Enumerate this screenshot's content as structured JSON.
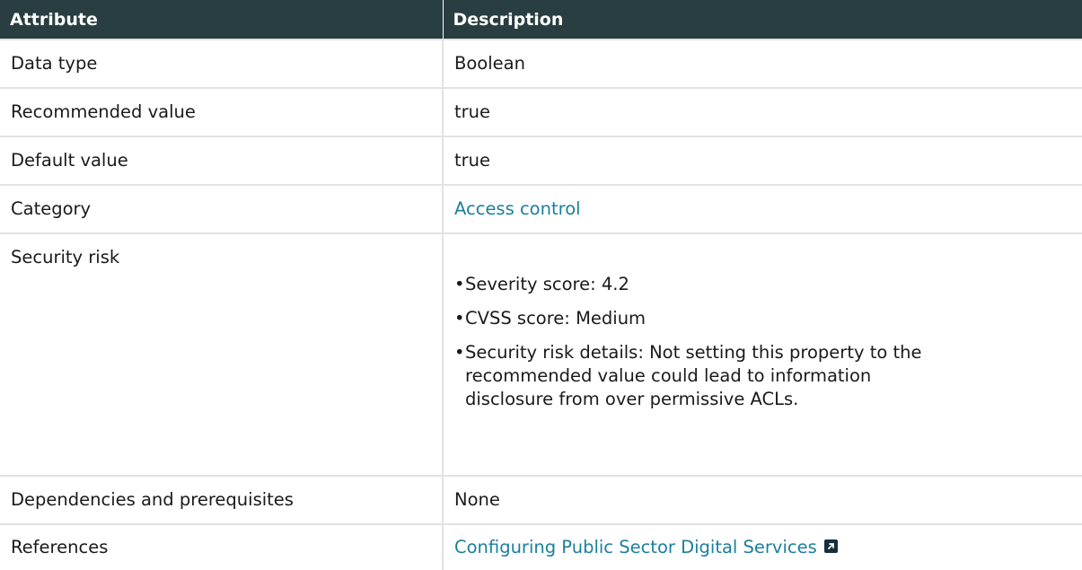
{
  "table": {
    "headers": [
      "Attribute",
      "Description"
    ],
    "rows": [
      {
        "attribute": "Data type",
        "value": "Boolean"
      },
      {
        "attribute": "Recommended value",
        "value": "true"
      },
      {
        "attribute": "Default value",
        "value": "true"
      },
      {
        "attribute": "Category",
        "value": "Access control"
      },
      {
        "attribute": "Security risk",
        "items": [
          "Severity score: 4.2",
          "CVSS score: Medium",
          "Security risk details: Not setting this property to the recommended value could lead to information disclosure from over permissive ACLs."
        ]
      },
      {
        "attribute": "Dependencies and prerequisites",
        "value": "None"
      },
      {
        "attribute": "References",
        "value": "Configuring Public Sector Digital Services"
      }
    ]
  },
  "icons": {
    "external_link": "external-link-icon"
  },
  "colors": {
    "header_bg": "#293e40",
    "link": "#1b7f9c"
  }
}
